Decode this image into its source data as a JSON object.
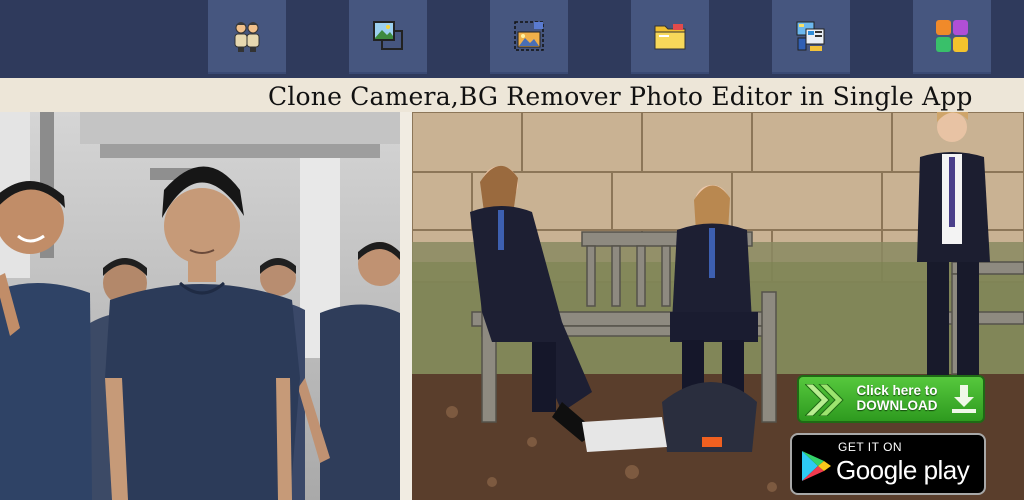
{
  "toolbar": {
    "items": [
      {
        "icon": "clone-people-icon"
      },
      {
        "icon": "photo-layers-icon"
      },
      {
        "icon": "crop-image-icon"
      },
      {
        "icon": "folder-icon"
      },
      {
        "icon": "app-screens-icon"
      },
      {
        "icon": "color-tiles-icon"
      }
    ]
  },
  "headline": "Clone Camera,BG Remover Photo Editor in Single App",
  "download": {
    "line1": "Click here to",
    "line2": "DOWNLOAD"
  },
  "store_badge": {
    "small": "GET IT ON",
    "big": "Google play"
  },
  "colors": {
    "toolbar_bg": "#2f3a5c",
    "tile_bg": "#46567f",
    "download_green": "#3fb22c",
    "headline_band": "#ede6d8"
  }
}
